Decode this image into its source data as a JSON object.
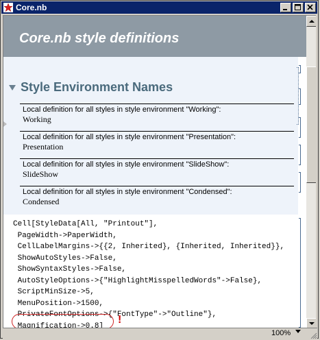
{
  "window": {
    "title": "Core.nb"
  },
  "header": {
    "title": "Core.nb style definitions"
  },
  "section": {
    "title": "Style Environment Names",
    "cells": [
      {
        "desc": "Local definition for all styles in style environment \"Working\":",
        "name": "Working"
      },
      {
        "desc": "Local definition for all styles in style environment \"Presentation\":",
        "name": "Presentation"
      },
      {
        "desc": "Local definition for all styles in style environment \"SlideShow\":",
        "name": "SlideShow"
      },
      {
        "desc": "Local definition for all styles in style environment \"Condensed\":",
        "name": "Condensed"
      }
    ]
  },
  "code": {
    "lines": [
      "Cell[StyleData[All, \"Printout\"],",
      " PageWidth->PaperWidth,",
      " CellLabelMargins->{{2, Inherited}, {Inherited, Inherited}},",
      " ShowAutoStyles->False,",
      " ShowSyntaxStyles->False,",
      " AutoStyleOptions->{\"HighlightMisspelledWords\"->False},",
      " ScriptMinSize->5,",
      " MenuPosition->1500,",
      " PrivateFontOptions->{\"FontType\"->\"Outline\"},",
      " Magnification->0.8]"
    ],
    "annotation": "!"
  },
  "statusbar": {
    "zoom": "100%"
  },
  "colors": {
    "titlebar": "#0a246a",
    "header_band": "#8e9aa4",
    "section_bg": "#eef3fa",
    "section_title": "#4a6a7c",
    "highlight": "#cc2222"
  }
}
